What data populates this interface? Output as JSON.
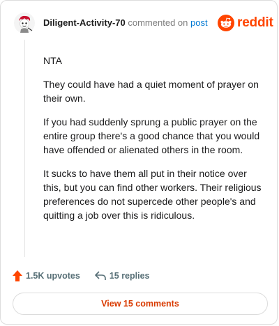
{
  "header": {
    "username": "Diligent-Activity-70",
    "commented_on": "commented on",
    "post_link": "post",
    "brand": "reddit"
  },
  "comment": {
    "paragraphs": [
      "NTA",
      "They could have had a quiet moment of prayer on their own.",
      "If you had suddenly sprung a public prayer on the entire group there's a good chance that you would have offended or alienated others in the room.",
      "It sucks to have them all put in their notice over this, but you can find other workers. Their religious preferences do not supercede other people's and quitting a job over this is ridiculous."
    ]
  },
  "actions": {
    "upvotes": "1.5K upvotes",
    "replies": "15 replies"
  },
  "view_button": "View 15 comments",
  "colors": {
    "brand": "#ff4500",
    "link": "#0079d3",
    "button_text": "#d93a00"
  },
  "icons": [
    "avatar",
    "reddit-logo-icon",
    "upvote-arrow-icon",
    "reply-arrow-icon"
  ]
}
